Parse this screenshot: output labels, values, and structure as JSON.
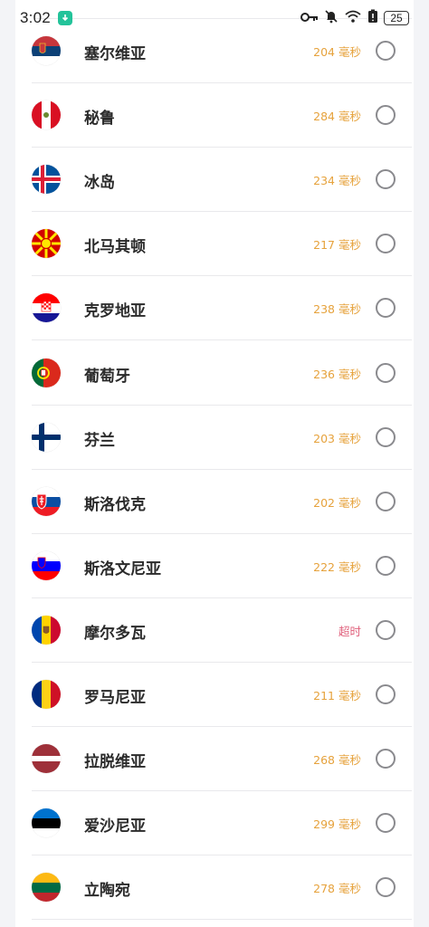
{
  "status_bar": {
    "time": "3:02",
    "battery": "25"
  },
  "servers": [
    {
      "name": "塞尔维亚",
      "latency": "204 毫秒",
      "timeout": false,
      "flag": "serbia"
    },
    {
      "name": "秘鲁",
      "latency": "284 毫秒",
      "timeout": false,
      "flag": "peru"
    },
    {
      "name": "冰岛",
      "latency": "234 毫秒",
      "timeout": false,
      "flag": "iceland"
    },
    {
      "name": "北马其顿",
      "latency": "217 毫秒",
      "timeout": false,
      "flag": "north-macedonia"
    },
    {
      "name": "克罗地亚",
      "latency": "238 毫秒",
      "timeout": false,
      "flag": "croatia"
    },
    {
      "name": "葡萄牙",
      "latency": "236 毫秒",
      "timeout": false,
      "flag": "portugal"
    },
    {
      "name": "芬兰",
      "latency": "203 毫秒",
      "timeout": false,
      "flag": "finland"
    },
    {
      "name": "斯洛伐克",
      "latency": "202 毫秒",
      "timeout": false,
      "flag": "slovakia"
    },
    {
      "name": "斯洛文尼亚",
      "latency": "222 毫秒",
      "timeout": false,
      "flag": "slovenia"
    },
    {
      "name": "摩尔多瓦",
      "latency": "超时",
      "timeout": true,
      "flag": "moldova"
    },
    {
      "name": "罗马尼亚",
      "latency": "211 毫秒",
      "timeout": false,
      "flag": "romania"
    },
    {
      "name": "拉脱维亚",
      "latency": "268 毫秒",
      "timeout": false,
      "flag": "latvia"
    },
    {
      "name": "爱沙尼亚",
      "latency": "299 毫秒",
      "timeout": false,
      "flag": "estonia"
    },
    {
      "name": "立陶宛",
      "latency": "278 毫秒",
      "timeout": false,
      "flag": "lithuania"
    }
  ],
  "colors": {
    "latency": "#e6a23c",
    "timeout": "#e0607c",
    "radio_border": "#8a8a8e"
  }
}
